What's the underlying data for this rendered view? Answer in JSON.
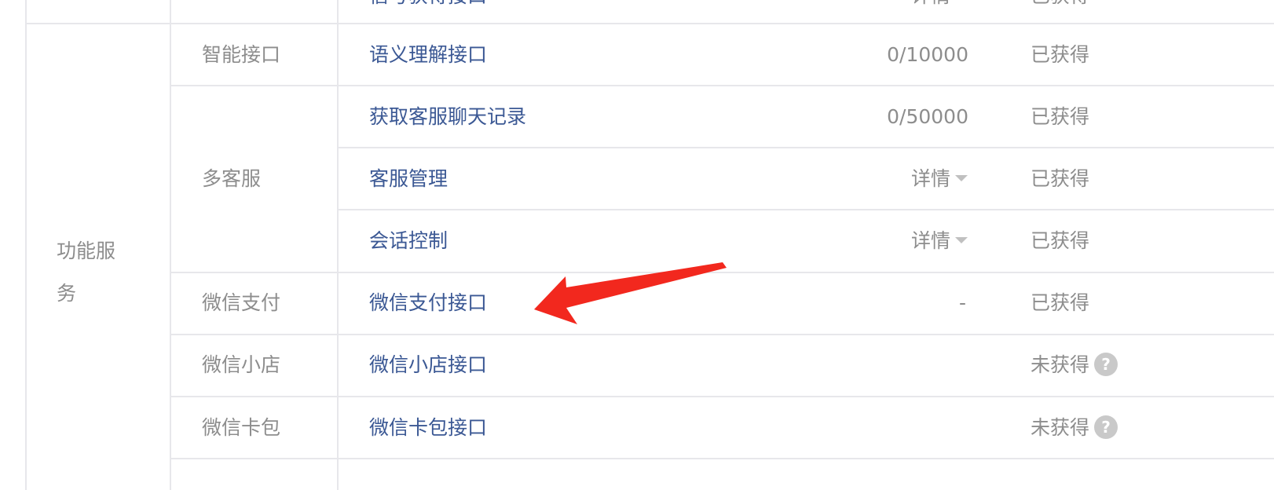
{
  "top_partial_row": {
    "api": "信号获得接口",
    "quota": "详情",
    "status": "已获得"
  },
  "category": {
    "label_line1": "功能服",
    "label_line2": "务"
  },
  "rows": [
    {
      "subcategory": "智能接口",
      "api": "语义理解接口",
      "quota": "0/10000",
      "status": "已获得"
    },
    {
      "subcategory": "多客服",
      "api": "获取客服聊天记录",
      "quota": "0/50000",
      "status": "已获得"
    },
    {
      "api": "客服管理",
      "quota": "详情",
      "status": "已获得"
    },
    {
      "api": "会话控制",
      "quota": "详情",
      "status": "已获得"
    },
    {
      "subcategory": "微信支付",
      "api": "微信支付接口",
      "quota": "-",
      "status": "已获得"
    },
    {
      "subcategory": "微信小店",
      "api": "微信小店接口",
      "status": "未获得"
    },
    {
      "subcategory": "微信卡包",
      "api": "微信卡包接口",
      "status": "未获得"
    }
  ],
  "help_glyph": "?",
  "annotation": {
    "color": "#f2281e",
    "icon": "red-arrow"
  }
}
